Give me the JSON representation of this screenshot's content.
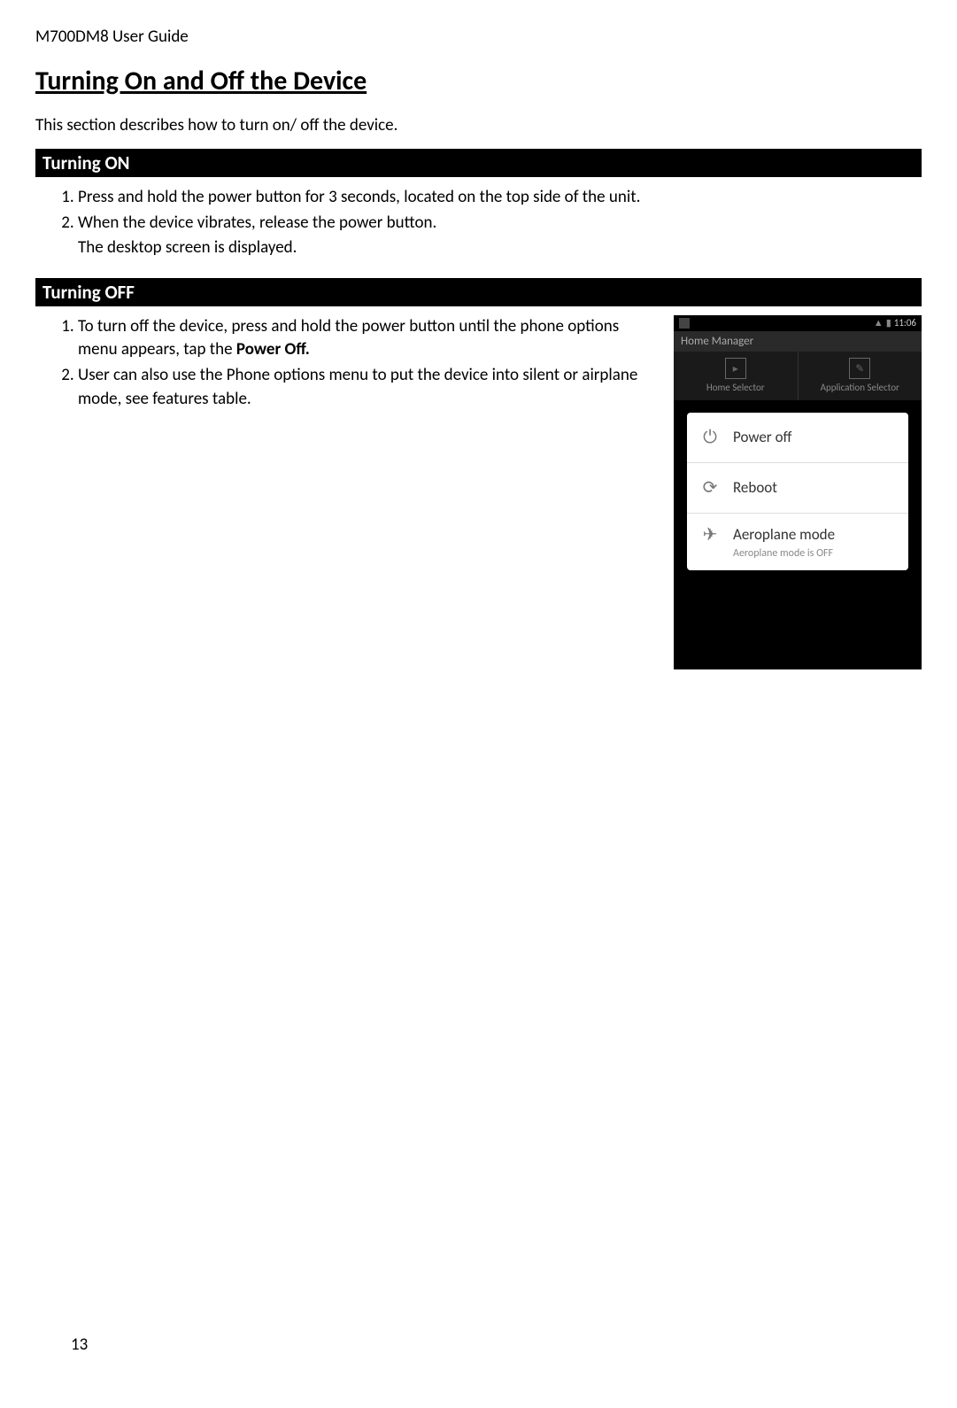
{
  "header": "M700DM8 User Guide",
  "title": "Turning On and Off the Device",
  "intro": "This section describes how to turn on/ off the device.",
  "section_on": {
    "heading": "Turning ON",
    "steps": [
      "Press and hold the power button for 3 seconds, located on the top side of the unit.",
      "When the device vibrates, release the power button."
    ],
    "sub_line": "The desktop screen is displayed."
  },
  "section_off": {
    "heading": "Turning OFF",
    "step1_prefix": "To turn off the device, press and hold the power button until the phone options menu appears, tap the ",
    "step1_bold": "Power Off.",
    "step2": "User can also use the Phone options menu to put the device into silent or airplane mode, see features table."
  },
  "phone": {
    "time": "11:06",
    "home_manager": "Home Manager",
    "home_selector": "Home Selector",
    "app_selector": "Application Selector",
    "dialog": {
      "power_off": "Power off",
      "reboot": "Reboot",
      "airplane": "Aeroplane mode",
      "airplane_sub": "Aeroplane mode is OFF"
    }
  },
  "page_number": "13"
}
